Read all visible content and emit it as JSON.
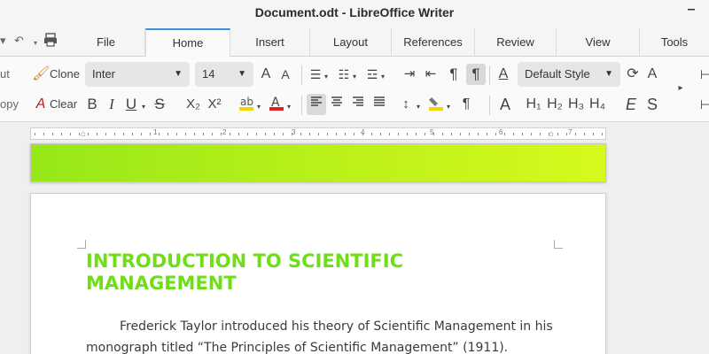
{
  "window": {
    "title": "Document.odt - LibreOffice Writer",
    "minimize_glyph": "–"
  },
  "tabs": [
    {
      "label": "File"
    },
    {
      "label": "Home"
    },
    {
      "label": "Insert"
    },
    {
      "label": "Layout"
    },
    {
      "label": "References"
    },
    {
      "label": "Review"
    },
    {
      "label": "View"
    },
    {
      "label": "Tools"
    }
  ],
  "active_tab": "Home",
  "clipboard": {
    "cut_label": "ut",
    "copy_label": "opy",
    "clone_label": "Clone",
    "clear_label": "Clear"
  },
  "font": {
    "name": "Inter",
    "size": "14"
  },
  "style": {
    "name": "Default Style"
  },
  "format_glyphs": {
    "bold": "B",
    "italic": "I",
    "underline": "U",
    "strike": "S",
    "subscript": "X₂",
    "superscript": "X²",
    "grow": "A",
    "shrink": "A",
    "pilcrow": "¶",
    "spell": "A",
    "style_a": "A",
    "h1": "H₁",
    "h2": "H₂",
    "h3": "H₃",
    "h4": "H₄",
    "emphasis": "E",
    "strong": "S"
  },
  "ruler": {
    "labels": [
      "1",
      "2",
      "3",
      "4",
      "5",
      "6",
      "7"
    ]
  },
  "document": {
    "heading": "INTRODUCTION TO SCIENTIFIC MANAGEMENT",
    "paragraph": "Frederick Taylor introduced his theory of Scientific Management in his monograph titled “The Principles of Scientific Management” (1911)."
  },
  "colors": {
    "accent_tab": "#3d8ee6",
    "heading_green": "#6ddf14",
    "highlight_yellow": "#f2d600",
    "font_red": "#e02020"
  }
}
